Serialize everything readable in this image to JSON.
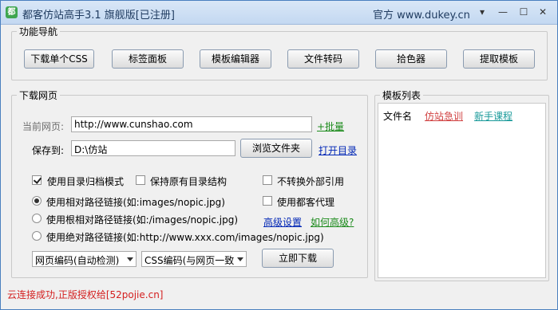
{
  "window": {
    "title": "都客仿站高手3.1 旗舰版[已注册]",
    "right_title": "官方 www.dukey.cn",
    "icon_text": "都",
    "controls": {
      "min": "▾",
      "minimize": "—",
      "maximize": "☐",
      "close": "✕"
    }
  },
  "nav": {
    "label": "功能导航",
    "buttons": [
      "下载单个CSS",
      "标签面板",
      "模板编辑器",
      "文件转码",
      "拾色器",
      "提取模板"
    ]
  },
  "download": {
    "label": "下载网页",
    "current_url_label": "当前网页:",
    "current_url_value": "http://www.cunshao.com",
    "batch_link": "+批量",
    "save_to_label": "保存到:",
    "save_to_value": "D:\\仿站",
    "browse_button": "浏览文件夹",
    "open_dir_link": "打开目录",
    "options": {
      "dir_archive": {
        "label": "使用目录归档模式",
        "checked": true
      },
      "keep_structure": {
        "label": "保持原有目录结构",
        "checked": false
      },
      "no_convert_external": {
        "label": "不转换外部引用",
        "checked": false
      },
      "use_proxy": {
        "label": "使用都客代理",
        "checked": false
      }
    },
    "path_modes": [
      {
        "label": "使用相对路径链接(如:images/nopic.jpg)",
        "checked": true
      },
      {
        "label": "使用根相对路径链接(如:/images/nopic.jpg)",
        "checked": false
      },
      {
        "label": "使用绝对路径链接(如:http://www.xxx.com/images/nopic.jpg)",
        "checked": false
      }
    ],
    "advanced_link": "高级设置",
    "how_advanced_link": "如何高级?",
    "page_encoding": "网页编码(自动检测)",
    "css_encoding": "CSS编码(与网页一致",
    "download_now": "立即下载"
  },
  "templates": {
    "label": "模板列表",
    "col_filename": "文件名",
    "link_fake": "仿站急训",
    "link_course": "新手课程"
  },
  "status": "云连接成功,正版授权给[52pojie.cn]",
  "colors": {
    "status_red": "#d42020",
    "link_green": "#1a8a1a",
    "link_blue": "#0026b5",
    "link_red": "#d04040",
    "link_teal": "#1a9a9a"
  }
}
